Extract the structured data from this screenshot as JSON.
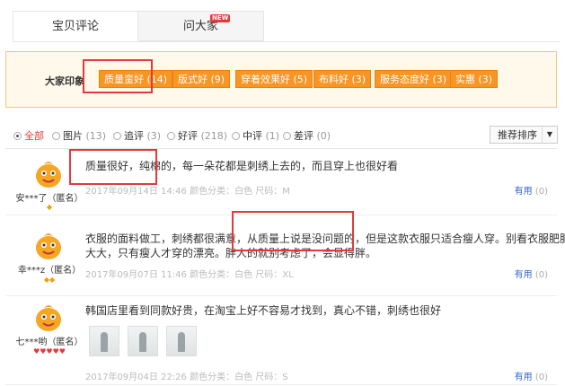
{
  "tabs": [
    {
      "label": "宝贝评论",
      "active": true
    },
    {
      "label": "问大家",
      "badge": "NEW"
    }
  ],
  "impression": {
    "label": "大家印象",
    "tags": [
      "质量蛮好 (14)",
      "版式好 (9)",
      "穿着效果好 (5)",
      "布料好 (3)",
      "服务态度好 (3)",
      "实惠 (3)"
    ]
  },
  "filters": [
    {
      "label": "全部",
      "count": "",
      "selected": true
    },
    {
      "label": "图片",
      "count": "(13)"
    },
    {
      "label": "追评",
      "count": "(3)"
    },
    {
      "label": "好评",
      "count": "(218)"
    },
    {
      "label": "中评",
      "count": "(1)"
    },
    {
      "label": "差评",
      "count": "(0)"
    }
  ],
  "sort": {
    "label": "推荐排序"
  },
  "reviews": [
    {
      "user": "安***了（匿名）",
      "text1": "质量很好，纯棉的，每一朵花都是刺绣上去的，而且穿上也很好看",
      "text2": "",
      "meta": "2017年09月14日 14:46    颜色分类：白色   尺码：M",
      "helpful": "有用",
      "helpful_count": "(0)",
      "rank_color": "#f0a000"
    },
    {
      "user": "幸***z（匿名）",
      "text1": "衣服的面料做工，刺绣都很满意，从质量上说是没问题的，但是这款衣服只适合瘦人穿。别看衣服肥肥",
      "text2": "大大，只有瘦人才穿的漂亮。胖人的就别考虑了，会显得胖。",
      "meta": "2017年09月07日 11:46    颜色分类：白色   尺码：XL",
      "helpful": "有用",
      "helpful_count": "(0)",
      "rank_color": "#f0a000"
    },
    {
      "user": "七***哟（匿名）",
      "text1": "韩国店里看到同款好贵，在淘宝上好不容易才找到，真心不错，刺绣也很好",
      "text2": "",
      "meta": "2017年09月04日 22:26    颜色分类：白色   尺码：S",
      "helpful": "有用",
      "helpful_count": "(0)",
      "rank_color": "#e4393c"
    }
  ]
}
